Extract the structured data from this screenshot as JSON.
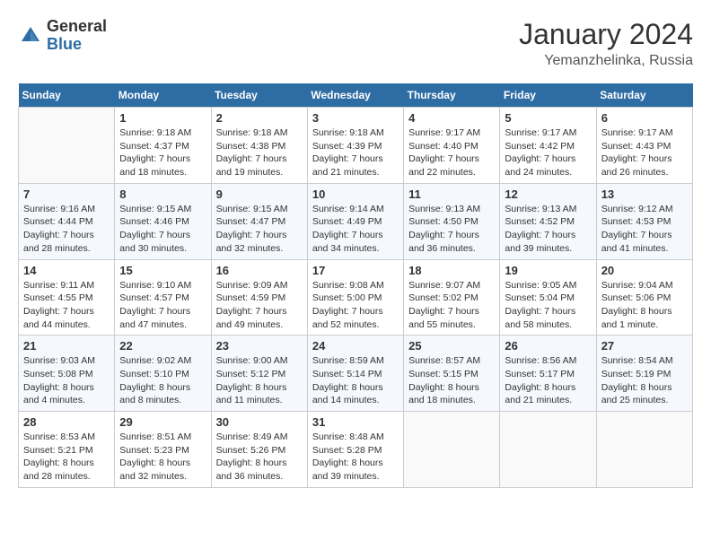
{
  "logo": {
    "general": "General",
    "blue": "Blue"
  },
  "title": "January 2024",
  "location": "Yemanzhelinka, Russia",
  "days_of_week": [
    "Sunday",
    "Monday",
    "Tuesday",
    "Wednesday",
    "Thursday",
    "Friday",
    "Saturday"
  ],
  "weeks": [
    [
      {
        "day": "",
        "info": ""
      },
      {
        "day": "1",
        "info": "Sunrise: 9:18 AM\nSunset: 4:37 PM\nDaylight: 7 hours\nand 18 minutes."
      },
      {
        "day": "2",
        "info": "Sunrise: 9:18 AM\nSunset: 4:38 PM\nDaylight: 7 hours\nand 19 minutes."
      },
      {
        "day": "3",
        "info": "Sunrise: 9:18 AM\nSunset: 4:39 PM\nDaylight: 7 hours\nand 21 minutes."
      },
      {
        "day": "4",
        "info": "Sunrise: 9:17 AM\nSunset: 4:40 PM\nDaylight: 7 hours\nand 22 minutes."
      },
      {
        "day": "5",
        "info": "Sunrise: 9:17 AM\nSunset: 4:42 PM\nDaylight: 7 hours\nand 24 minutes."
      },
      {
        "day": "6",
        "info": "Sunrise: 9:17 AM\nSunset: 4:43 PM\nDaylight: 7 hours\nand 26 minutes."
      }
    ],
    [
      {
        "day": "7",
        "info": "Sunrise: 9:16 AM\nSunset: 4:44 PM\nDaylight: 7 hours\nand 28 minutes."
      },
      {
        "day": "8",
        "info": "Sunrise: 9:15 AM\nSunset: 4:46 PM\nDaylight: 7 hours\nand 30 minutes."
      },
      {
        "day": "9",
        "info": "Sunrise: 9:15 AM\nSunset: 4:47 PM\nDaylight: 7 hours\nand 32 minutes."
      },
      {
        "day": "10",
        "info": "Sunrise: 9:14 AM\nSunset: 4:49 PM\nDaylight: 7 hours\nand 34 minutes."
      },
      {
        "day": "11",
        "info": "Sunrise: 9:13 AM\nSunset: 4:50 PM\nDaylight: 7 hours\nand 36 minutes."
      },
      {
        "day": "12",
        "info": "Sunrise: 9:13 AM\nSunset: 4:52 PM\nDaylight: 7 hours\nand 39 minutes."
      },
      {
        "day": "13",
        "info": "Sunrise: 9:12 AM\nSunset: 4:53 PM\nDaylight: 7 hours\nand 41 minutes."
      }
    ],
    [
      {
        "day": "14",
        "info": "Sunrise: 9:11 AM\nSunset: 4:55 PM\nDaylight: 7 hours\nand 44 minutes."
      },
      {
        "day": "15",
        "info": "Sunrise: 9:10 AM\nSunset: 4:57 PM\nDaylight: 7 hours\nand 47 minutes."
      },
      {
        "day": "16",
        "info": "Sunrise: 9:09 AM\nSunset: 4:59 PM\nDaylight: 7 hours\nand 49 minutes."
      },
      {
        "day": "17",
        "info": "Sunrise: 9:08 AM\nSunset: 5:00 PM\nDaylight: 7 hours\nand 52 minutes."
      },
      {
        "day": "18",
        "info": "Sunrise: 9:07 AM\nSunset: 5:02 PM\nDaylight: 7 hours\nand 55 minutes."
      },
      {
        "day": "19",
        "info": "Sunrise: 9:05 AM\nSunset: 5:04 PM\nDaylight: 7 hours\nand 58 minutes."
      },
      {
        "day": "20",
        "info": "Sunrise: 9:04 AM\nSunset: 5:06 PM\nDaylight: 8 hours\nand 1 minute."
      }
    ],
    [
      {
        "day": "21",
        "info": "Sunrise: 9:03 AM\nSunset: 5:08 PM\nDaylight: 8 hours\nand 4 minutes."
      },
      {
        "day": "22",
        "info": "Sunrise: 9:02 AM\nSunset: 5:10 PM\nDaylight: 8 hours\nand 8 minutes."
      },
      {
        "day": "23",
        "info": "Sunrise: 9:00 AM\nSunset: 5:12 PM\nDaylight: 8 hours\nand 11 minutes."
      },
      {
        "day": "24",
        "info": "Sunrise: 8:59 AM\nSunset: 5:14 PM\nDaylight: 8 hours\nand 14 minutes."
      },
      {
        "day": "25",
        "info": "Sunrise: 8:57 AM\nSunset: 5:15 PM\nDaylight: 8 hours\nand 18 minutes."
      },
      {
        "day": "26",
        "info": "Sunrise: 8:56 AM\nSunset: 5:17 PM\nDaylight: 8 hours\nand 21 minutes."
      },
      {
        "day": "27",
        "info": "Sunrise: 8:54 AM\nSunset: 5:19 PM\nDaylight: 8 hours\nand 25 minutes."
      }
    ],
    [
      {
        "day": "28",
        "info": "Sunrise: 8:53 AM\nSunset: 5:21 PM\nDaylight: 8 hours\nand 28 minutes."
      },
      {
        "day": "29",
        "info": "Sunrise: 8:51 AM\nSunset: 5:23 PM\nDaylight: 8 hours\nand 32 minutes."
      },
      {
        "day": "30",
        "info": "Sunrise: 8:49 AM\nSunset: 5:26 PM\nDaylight: 8 hours\nand 36 minutes."
      },
      {
        "day": "31",
        "info": "Sunrise: 8:48 AM\nSunset: 5:28 PM\nDaylight: 8 hours\nand 39 minutes."
      },
      {
        "day": "",
        "info": ""
      },
      {
        "day": "",
        "info": ""
      },
      {
        "day": "",
        "info": ""
      }
    ]
  ]
}
